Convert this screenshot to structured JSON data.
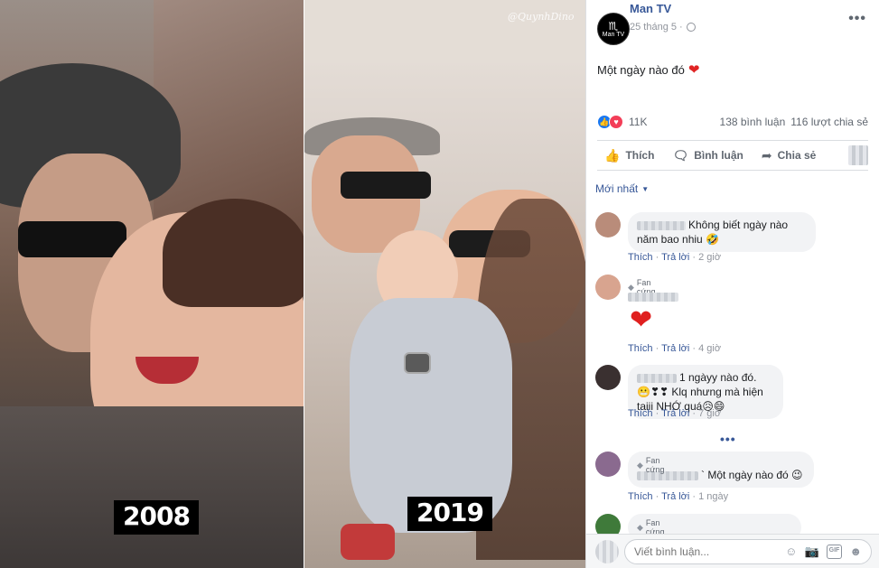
{
  "photo": {
    "left_label": "2008",
    "right_label": "2019",
    "watermark": "@QuynhDino"
  },
  "post": {
    "page_name": "Man TV",
    "avatar_text": "Man TV",
    "timestamp": "25 tháng 5 ·",
    "more": "•••",
    "caption": "Một ngày nào đó",
    "caption_emoji": "❤",
    "reaction_count": "11K",
    "comments_count": "138 bình luận",
    "shares_count": "116 lượt chia sẻ",
    "actions": {
      "like": "Thích",
      "comment": "Bình luận",
      "share": "Chia sẻ"
    },
    "sort_label": "Mới nhất"
  },
  "comments": [
    {
      "text": "Không biết ngày nào năm bao nhiu 🤣",
      "like": "Thích",
      "reply": "Trả lời",
      "time": "2 giờ",
      "avatar_color": "#b98c7a"
    },
    {
      "badge": "Fan cứng",
      "emoji": "❤",
      "like": "Thích",
      "reply": "Trả lời",
      "time": "4 giờ",
      "avatar_color": "#d8a48f"
    },
    {
      "text": "1 ngàyy nào đó.😬❣❣ Klq nhưng mà hiện taiii NHỚ quá😥😄",
      "like": "Thích",
      "reply": "Trả lời",
      "time": "7 giờ",
      "avatar_color": "#3a3030"
    },
    {
      "badge": "Fan cứng",
      "text": "` Một ngày nào đó 😉",
      "like": "Thích",
      "reply": "Trả lời",
      "time": "1 ngày",
      "avatar_color": "#8a6a8f"
    },
    {
      "badge": "Fan cứng",
      "avatar_color": "#3f7a3a"
    }
  ],
  "more_replies": "•••",
  "composer": {
    "placeholder": "Viết bình luận...",
    "icons": [
      "emoji-icon",
      "camera-icon",
      "gif-icon",
      "sticker-icon"
    ],
    "gif_text": "GIF"
  }
}
